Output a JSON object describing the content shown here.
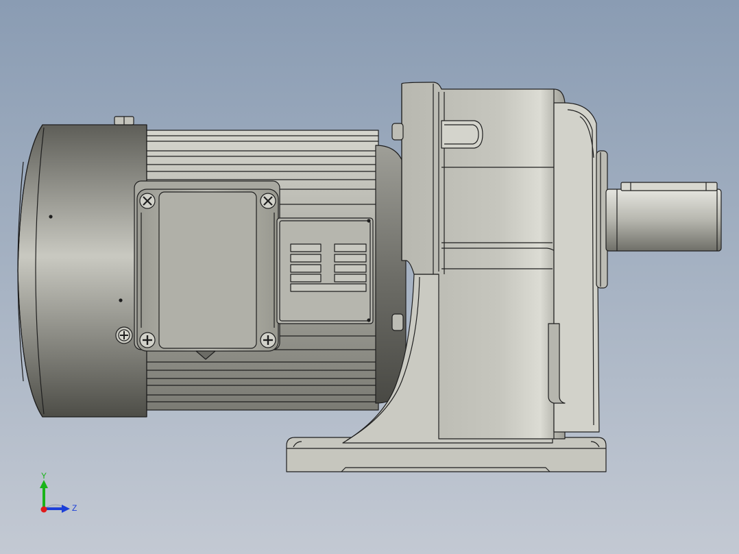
{
  "viewport": {
    "background_top": "#8a9cb3",
    "background_bottom": "#c3c9d3"
  },
  "model": {
    "body_color": "#c8c8c0",
    "edge_color": "#1e1e1e"
  },
  "triad": {
    "y_label": "Y",
    "z_label": "Z",
    "y_color": "#19b419",
    "z_color": "#1c3fd8",
    "x_color": "#e01b1b"
  }
}
